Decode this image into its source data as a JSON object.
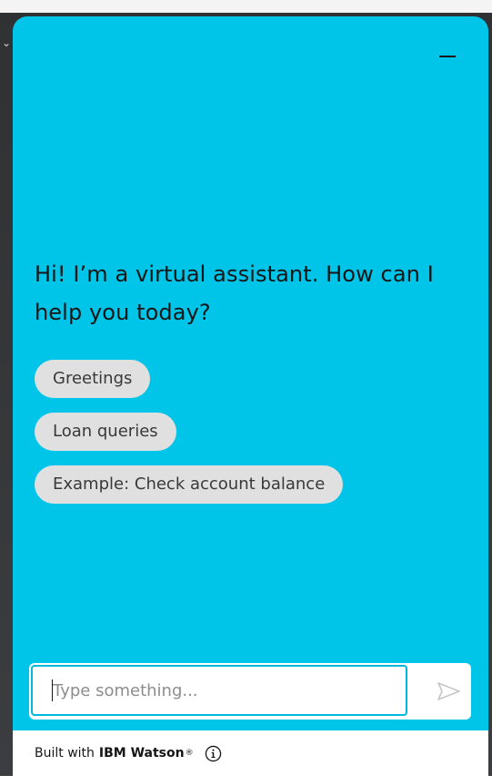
{
  "assistant": {
    "greeting": "Hi! I’m a virtual assistant. How can I help you today?",
    "suggestions": [
      {
        "label": "Greetings"
      },
      {
        "label": "Loan queries"
      },
      {
        "label": "Example: Check account balance"
      }
    ]
  },
  "input": {
    "placeholder": "Type something...",
    "value": ""
  },
  "footer": {
    "prefix": "Built with",
    "brand": "IBM Watson",
    "mark": "®"
  },
  "icons": {
    "minimize": "minimize-icon",
    "send": "send-icon",
    "info": "info-icon"
  },
  "colors": {
    "panel": "#00c4e8",
    "chip": "#e0e0e0",
    "input_border": "#00b8db"
  }
}
